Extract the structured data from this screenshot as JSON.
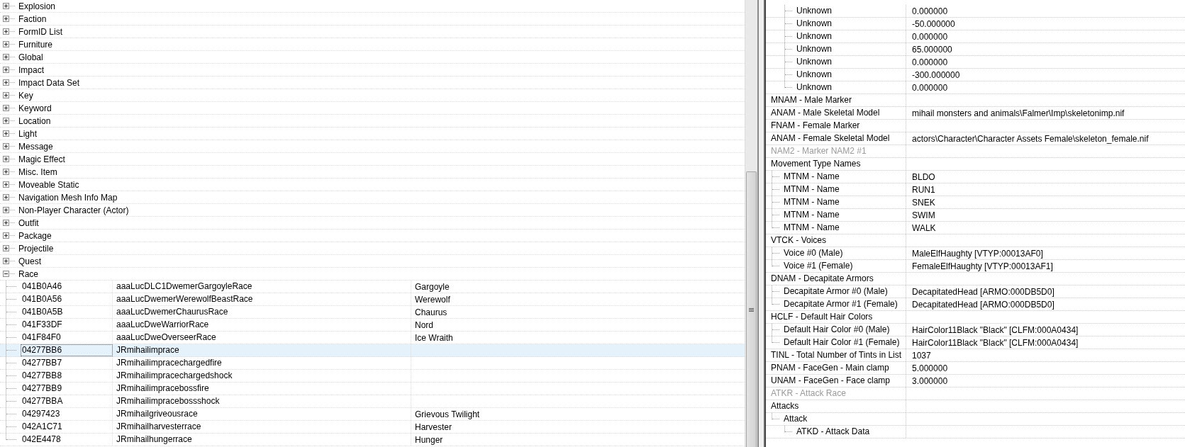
{
  "categories": [
    {
      "label": "Explosion",
      "expanded": false
    },
    {
      "label": "Faction",
      "expanded": false
    },
    {
      "label": "FormID List",
      "expanded": false
    },
    {
      "label": "Furniture",
      "expanded": false
    },
    {
      "label": "Global",
      "expanded": false
    },
    {
      "label": "Impact",
      "expanded": false
    },
    {
      "label": "Impact Data Set",
      "expanded": false
    },
    {
      "label": "Key",
      "expanded": false
    },
    {
      "label": "Keyword",
      "expanded": false
    },
    {
      "label": "Location",
      "expanded": false
    },
    {
      "label": "Light",
      "expanded": false
    },
    {
      "label": "Message",
      "expanded": false
    },
    {
      "label": "Magic Effect",
      "expanded": false
    },
    {
      "label": "Misc. Item",
      "expanded": false
    },
    {
      "label": "Moveable Static",
      "expanded": false
    },
    {
      "label": "Navigation Mesh Info Map",
      "expanded": false
    },
    {
      "label": "Non-Player Character (Actor)",
      "expanded": false
    },
    {
      "label": "Outfit",
      "expanded": false
    },
    {
      "label": "Package",
      "expanded": false
    },
    {
      "label": "Projectile",
      "expanded": false
    },
    {
      "label": "Quest",
      "expanded": false
    },
    {
      "label": "Race",
      "expanded": true,
      "records": [
        {
          "form_id": "041B0A46",
          "editor_id": "aaaLucDLC1DwemerGargoyleRace",
          "name": "Gargoyle",
          "selected": false
        },
        {
          "form_id": "041B0A56",
          "editor_id": "aaaLucDwemerWerewolfBeastRace",
          "name": "Werewolf",
          "selected": false
        },
        {
          "form_id": "041B0A5B",
          "editor_id": "aaaLucDwemerChaurusRace",
          "name": "Chaurus",
          "selected": false
        },
        {
          "form_id": "041F33DF",
          "editor_id": "aaaLucDweWarriorRace",
          "name": "Nord",
          "selected": false
        },
        {
          "form_id": "041F84F0",
          "editor_id": "aaaLucDweOverseerRace",
          "name": "Ice Wraith",
          "selected": false
        },
        {
          "form_id": "04277BB6",
          "editor_id": "JRmihailimprace",
          "selected": true
        },
        {
          "form_id": "04277BB7",
          "editor_id": "JRmihailimpracechargedfire",
          "selected": false
        },
        {
          "form_id": "04277BB8",
          "editor_id": "JRmihailimpracechargedshock",
          "selected": false
        },
        {
          "form_id": "04277BB9",
          "editor_id": "JRmihailimpracebossfire",
          "selected": false
        },
        {
          "form_id": "04277BBA",
          "editor_id": "JRmihailimpracebossshock",
          "selected": false
        },
        {
          "form_id": "04297423",
          "editor_id": "JRmihailgriveousrace",
          "name": "Grievous Twilight",
          "selected": false
        },
        {
          "form_id": "042A1C71",
          "editor_id": "JRmihailharvesterrace",
          "name": "Harvester",
          "selected": false
        },
        {
          "form_id": "042E4478",
          "editor_id": "JRmihailhungerrace",
          "name": "Hunger",
          "selected": false
        }
      ]
    }
  ],
  "record_fields": [
    {
      "children": [
        {
          "children": [
            {
              "label": "Unknown",
              "value": "0.000000"
            },
            {
              "label": "Unknown",
              "value": "-50.000000"
            },
            {
              "label": "Unknown",
              "value": "0.000000"
            },
            {
              "label": "Unknown",
              "value": "65.000000"
            },
            {
              "label": "Unknown",
              "value": "0.000000"
            },
            {
              "label": "Unknown",
              "value": "-300.000000"
            },
            {
              "label": "Unknown",
              "value": "0.000000"
            }
          ]
        }
      ]
    },
    {
      "label": "MNAM - Male Marker",
      "disabled": false
    },
    {
      "label": "ANAM - Male Skeletal Model",
      "value": "mihail monsters and animals\\Falmer\\Imp\\skeletonimp.nif",
      "disabled": false
    },
    {
      "label": "FNAM - Female Marker",
      "disabled": false
    },
    {
      "label": "ANAM - Female Skeletal Model",
      "value": "actors\\Character\\Character Assets Female\\skeleton_female.nif",
      "disabled": false
    },
    {
      "label": "NAM2 - Marker NAM2 #1",
      "disabled": true
    },
    {
      "label": "Movement Type Names",
      "disabled": false,
      "children": [
        {
          "label": "MTNM - Name",
          "value": "BLDO"
        },
        {
          "label": "MTNM - Name",
          "value": "RUN1"
        },
        {
          "label": "MTNM - Name",
          "value": "SNEK"
        },
        {
          "label": "MTNM - Name",
          "value": "SWIM"
        },
        {
          "label": "MTNM - Name",
          "value": "WALK"
        }
      ]
    },
    {
      "label": "VTCK - Voices",
      "disabled": false,
      "children": [
        {
          "label": "Voice #0 (Male)",
          "value": "MaleElfHaughty [VTYP:00013AF0]"
        },
        {
          "label": "Voice #1 (Female)",
          "value": "FemaleElfHaughty [VTYP:00013AF1]"
        }
      ]
    },
    {
      "label": "DNAM - Decapitate Armors",
      "disabled": false,
      "children": [
        {
          "label": "Decapitate Armor #0 (Male)",
          "value": "DecapitatedHead [ARMO:000DB5D0]"
        },
        {
          "label": "Decapitate Armor #1 (Female)",
          "value": "DecapitatedHead [ARMO:000DB5D0]"
        }
      ]
    },
    {
      "label": "HCLF - Default Hair Colors",
      "disabled": false,
      "children": [
        {
          "label": "Default Hair Color #0 (Male)",
          "value": "HairColor11Black \"Black\" [CLFM:000A0434]"
        },
        {
          "label": "Default Hair Color #1 (Female)",
          "value": "HairColor11Black \"Black\" [CLFM:000A0434]"
        }
      ]
    },
    {
      "label": "TINL - Total Number of Tints in List",
      "value": "1037",
      "disabled": false
    },
    {
      "label": "PNAM - FaceGen - Main clamp",
      "value": "5.000000",
      "disabled": false
    },
    {
      "label": "UNAM - FaceGen - Face clamp",
      "value": "3.000000",
      "disabled": false
    },
    {
      "label": "ATKR - Attack Race",
      "disabled": true
    },
    {
      "label": "Attacks",
      "disabled": false,
      "children": [
        {
          "label": "Attack",
          "children": [
            {
              "label": "ATKD - Attack Data"
            }
          ]
        }
      ]
    }
  ]
}
